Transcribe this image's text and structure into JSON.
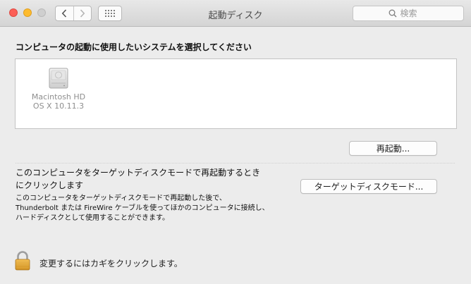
{
  "window": {
    "title": "起動ディスク",
    "search_placeholder": "検索"
  },
  "main": {
    "heading": "コンピュータの起動に使用したいシステムを選択してください",
    "disks": [
      {
        "name": "Macintosh HD",
        "os": "OS X 10.11.3",
        "icon": "internal-hard-drive-icon"
      }
    ],
    "restart_button": "再起動...",
    "target_mode": {
      "title_line1": "このコンピュータをターゲットディスクモードで再起動するとき",
      "title_line2": "にクリックします",
      "desc_line1": "このコンピュータをターゲットディスクモードで再起動した後で、",
      "desc_line2": "Thunderbolt または FireWire ケーブルを使ってほかのコンピュータに接続し、",
      "desc_line3": "ハードディスクとして使用することができます。",
      "button": "ターゲットディスクモード..."
    }
  },
  "footer": {
    "lock_text": "変更するにはカギをクリックします。",
    "lock_icon": "padlock-icon"
  }
}
